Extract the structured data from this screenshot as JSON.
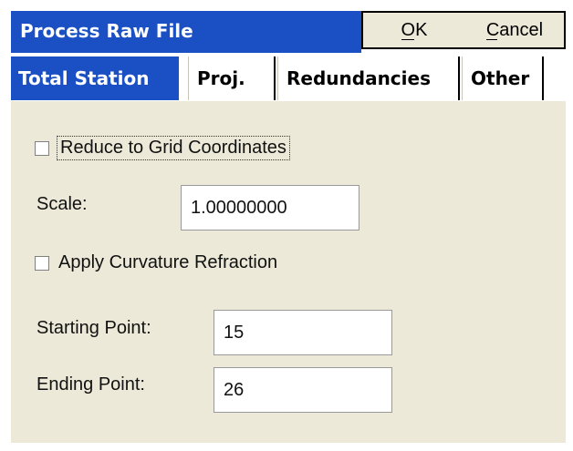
{
  "dialog": {
    "title": "Process Raw File",
    "ok_label": "OK",
    "cancel_label": "Cancel"
  },
  "tabs": [
    {
      "label": "Total Station",
      "active": true
    },
    {
      "label": "Proj.",
      "active": false
    },
    {
      "label": "Redundancies",
      "active": false
    },
    {
      "label": "Other",
      "active": false
    }
  ],
  "form": {
    "reduce_grid": {
      "label": "Reduce to Grid Coordinates",
      "checked": false
    },
    "scale": {
      "label": "Scale:",
      "value": "1.00000000"
    },
    "curvature": {
      "label": "Apply Curvature Refraction",
      "checked": false
    },
    "starting_point": {
      "label": "Starting Point:",
      "value": "15"
    },
    "ending_point": {
      "label": "Ending Point:",
      "value": "26"
    }
  },
  "colors": {
    "title_bar": "#1b4fc4",
    "panel": "#ece9d8"
  }
}
